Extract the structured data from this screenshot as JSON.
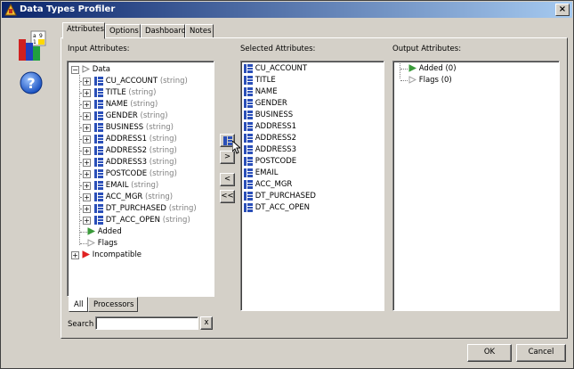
{
  "window": {
    "title": "Data Types Profiler",
    "close_glyph": "×"
  },
  "tabs": [
    {
      "label": "Attributes",
      "active": true
    },
    {
      "label": "Options",
      "active": false
    },
    {
      "label": "Dashboard",
      "active": false
    },
    {
      "label": "Notes",
      "active": false
    }
  ],
  "input_panel": {
    "label": "Input Attributes:",
    "root": "Data",
    "attributes": [
      {
        "name": "CU_ACCOUNT",
        "type": "(string)"
      },
      {
        "name": "TITLE",
        "type": "(string)"
      },
      {
        "name": "NAME",
        "type": "(string)"
      },
      {
        "name": "GENDER",
        "type": "(string)"
      },
      {
        "name": "BUSINESS",
        "type": "(string)"
      },
      {
        "name": "ADDRESS1",
        "type": "(string)"
      },
      {
        "name": "ADDRESS2",
        "type": "(string)"
      },
      {
        "name": "ADDRESS3",
        "type": "(string)"
      },
      {
        "name": "POSTCODE",
        "type": "(string)"
      },
      {
        "name": "EMAIL",
        "type": "(string)"
      },
      {
        "name": "ACC_MGR",
        "type": "(string)"
      },
      {
        "name": "DT_PURCHASED",
        "type": "(string)"
      },
      {
        "name": "DT_ACC_OPEN",
        "type": "(string)"
      }
    ],
    "groups": [
      "Added",
      "Flags",
      "Incompatible"
    ],
    "bottom_tabs": [
      "All",
      "Processors"
    ],
    "search_label": "Search",
    "search_value": "",
    "search_clear": "x"
  },
  "move_buttons": [
    ">",
    "<",
    "<<"
  ],
  "selected_panel": {
    "label": "Selected Attributes:",
    "items": [
      "CU_ACCOUNT",
      "TITLE",
      "NAME",
      "GENDER",
      "BUSINESS",
      "ADDRESS1",
      "ADDRESS2",
      "ADDRESS3",
      "POSTCODE",
      "EMAIL",
      "ACC_MGR",
      "DT_PURCHASED",
      "DT_ACC_OPEN"
    ]
  },
  "output_panel": {
    "label": "Output Attributes:",
    "items": [
      "Added (0)",
      "Flags (0)"
    ]
  },
  "footer": {
    "ok_label": "OK",
    "cancel_label": "Cancel"
  },
  "colors": {
    "title_start": "#0a246a",
    "title_end": "#a6caf0",
    "face": "#d4d0c8",
    "attr_icon": "#2a4fb8",
    "arrow_red": "#e02020",
    "arrow_green": "#3a9a3a"
  }
}
